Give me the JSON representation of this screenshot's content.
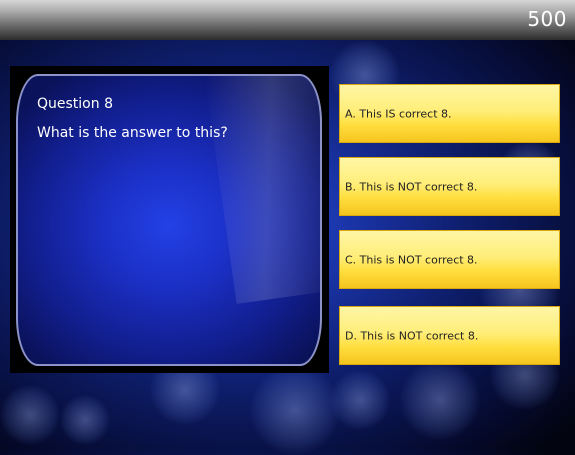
{
  "score": "500",
  "question": {
    "number_label": "Question 8",
    "text": "What is the answer to this?"
  },
  "answers": [
    {
      "label": "A. This IS correct 8."
    },
    {
      "label": "B. This is NOT correct 8."
    },
    {
      "label": "C. This is NOT correct 8."
    },
    {
      "label": "D. This is NOT correct 8."
    }
  ],
  "colors": {
    "background": "#1a34a8",
    "answer_fill": "#ffe04a",
    "screen_fill": "#1b2fc4",
    "screen_border": "#8c93c9"
  }
}
